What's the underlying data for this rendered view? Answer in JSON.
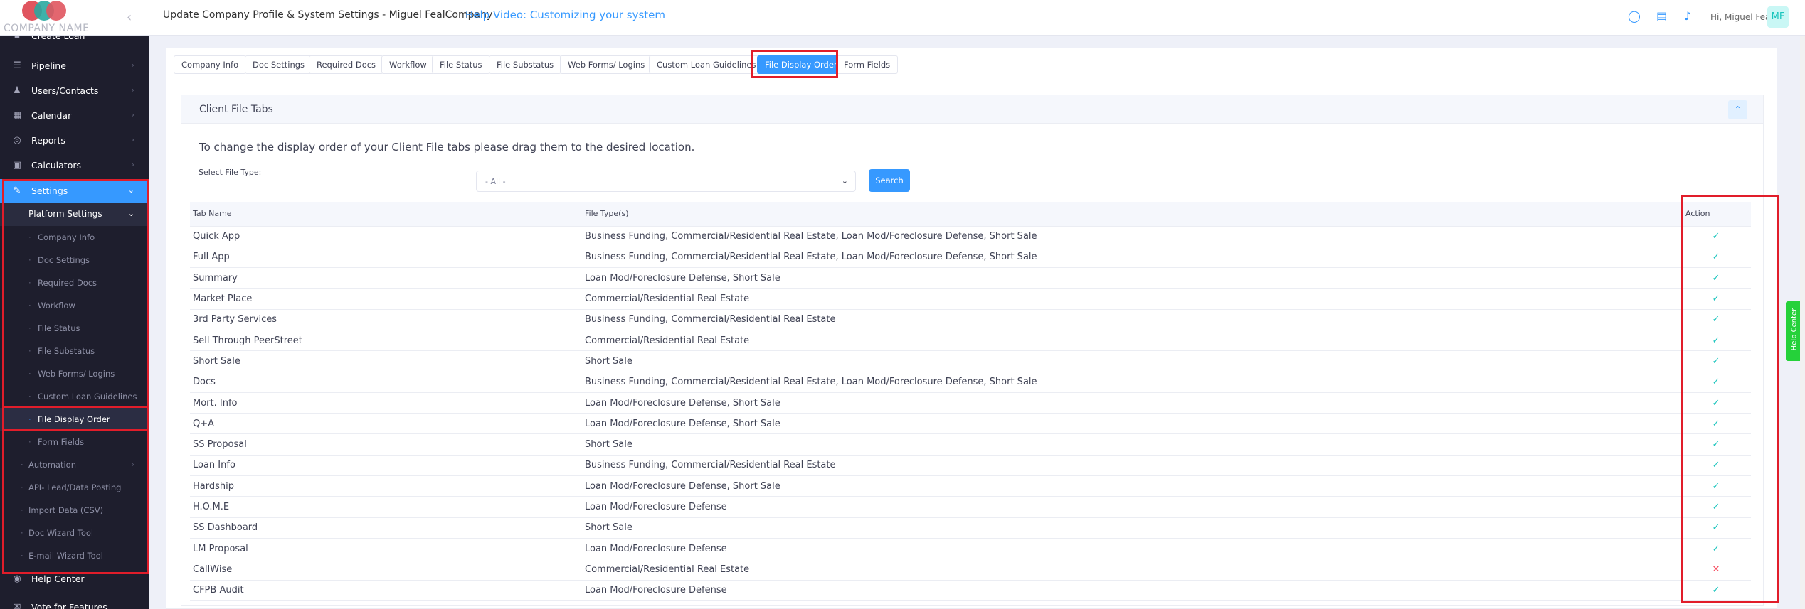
{
  "header": {
    "logo_text": "COMPANY NAME",
    "title": "Update Company Profile & System Settings - Miguel FealCompany",
    "help_video": "Help Video: Customizing your system",
    "greeting": "Hi, Miguel Feal",
    "avatar_initials": "MF"
  },
  "sidebar": {
    "top_partial": "Create Loan",
    "items": [
      {
        "label": "Pipeline",
        "icon": "list-icon"
      },
      {
        "label": "Users/Contacts",
        "icon": "user-icon"
      },
      {
        "label": "Calendar",
        "icon": "calendar-icon"
      },
      {
        "label": "Reports",
        "icon": "reports-icon"
      },
      {
        "label": "Calculators",
        "icon": "calculator-icon"
      },
      {
        "label": "Settings",
        "icon": "wrench-icon"
      }
    ],
    "platform_settings": "Platform Settings",
    "children": [
      "Company Info",
      "Doc Settings",
      "Required Docs",
      "Workflow",
      "File Status",
      "File Substatus",
      "Web Forms/ Logins",
      "Custom Loan Guidelines",
      "File Display Order",
      "Form Fields"
    ],
    "extras": [
      "Automation",
      "API- Lead/Data Posting",
      "Import Data (CSV)",
      "Doc Wizard Tool",
      "E-mail Wizard Tool"
    ],
    "help_center": "Help Center",
    "vote": "Vote for Features"
  },
  "tabs": [
    "Company Info",
    "Doc Settings",
    "Required Docs",
    "Workflow",
    "File Status",
    "File Substatus",
    "Web Forms/ Logins",
    "Custom Loan Guidelines",
    "File Display Order",
    "Form Fields"
  ],
  "card": {
    "title": "Client File Tabs",
    "instructions": "To change the display order of your Client File tabs please drag them to the desired location.",
    "file_type_label": "Select File Type:",
    "file_type_value": "- All -",
    "search_label": "Search"
  },
  "table": {
    "headers": {
      "name": "Tab Name",
      "types": "File Type(s)",
      "action": "Action"
    },
    "rows": [
      {
        "name": "Quick App",
        "types": "Business Funding, Commercial/Residential Real Estate, Loan Mod/Foreclosure Defense, Short Sale",
        "active": true
      },
      {
        "name": "Full App",
        "types": "Business Funding, Commercial/Residential Real Estate, Loan Mod/Foreclosure Defense, Short Sale",
        "active": true
      },
      {
        "name": "Summary",
        "types": "Loan Mod/Foreclosure Defense, Short Sale",
        "active": true
      },
      {
        "name": "Market Place",
        "types": "Commercial/Residential Real Estate",
        "active": true
      },
      {
        "name": "3rd Party Services",
        "types": "Business Funding, Commercial/Residential Real Estate",
        "active": true
      },
      {
        "name": "Sell Through PeerStreet",
        "types": "Commercial/Residential Real Estate",
        "active": true
      },
      {
        "name": "Short Sale",
        "types": "Short Sale",
        "active": true
      },
      {
        "name": "Docs",
        "types": "Business Funding, Commercial/Residential Real Estate, Loan Mod/Foreclosure Defense, Short Sale",
        "active": true
      },
      {
        "name": "Mort. Info",
        "types": "Loan Mod/Foreclosure Defense, Short Sale",
        "active": true
      },
      {
        "name": "Q+A",
        "types": "Loan Mod/Foreclosure Defense, Short Sale",
        "active": true
      },
      {
        "name": "SS Proposal",
        "types": "Short Sale",
        "active": true
      },
      {
        "name": "Loan Info",
        "types": "Business Funding, Commercial/Residential Real Estate",
        "active": true
      },
      {
        "name": "Hardship",
        "types": "Loan Mod/Foreclosure Defense, Short Sale",
        "active": true
      },
      {
        "name": "H.O.M.E",
        "types": "Loan Mod/Foreclosure Defense",
        "active": true
      },
      {
        "name": "SS Dashboard",
        "types": "Short Sale",
        "active": true
      },
      {
        "name": "LM Proposal",
        "types": "Loan Mod/Foreclosure Defense",
        "active": true
      },
      {
        "name": "CallWise",
        "types": "Commercial/Residential Real Estate",
        "active": false
      },
      {
        "name": "CFPB Audit",
        "types": "Loan Mod/Foreclosure Defense",
        "active": true
      }
    ]
  },
  "help_center_tab": "Help Center",
  "colors": {
    "accent": "#3699ff",
    "sidebar_bg": "#1e1e2d",
    "highlight": "#e11d2a",
    "success": "#1bc5bd",
    "danger": "#f64e60"
  }
}
